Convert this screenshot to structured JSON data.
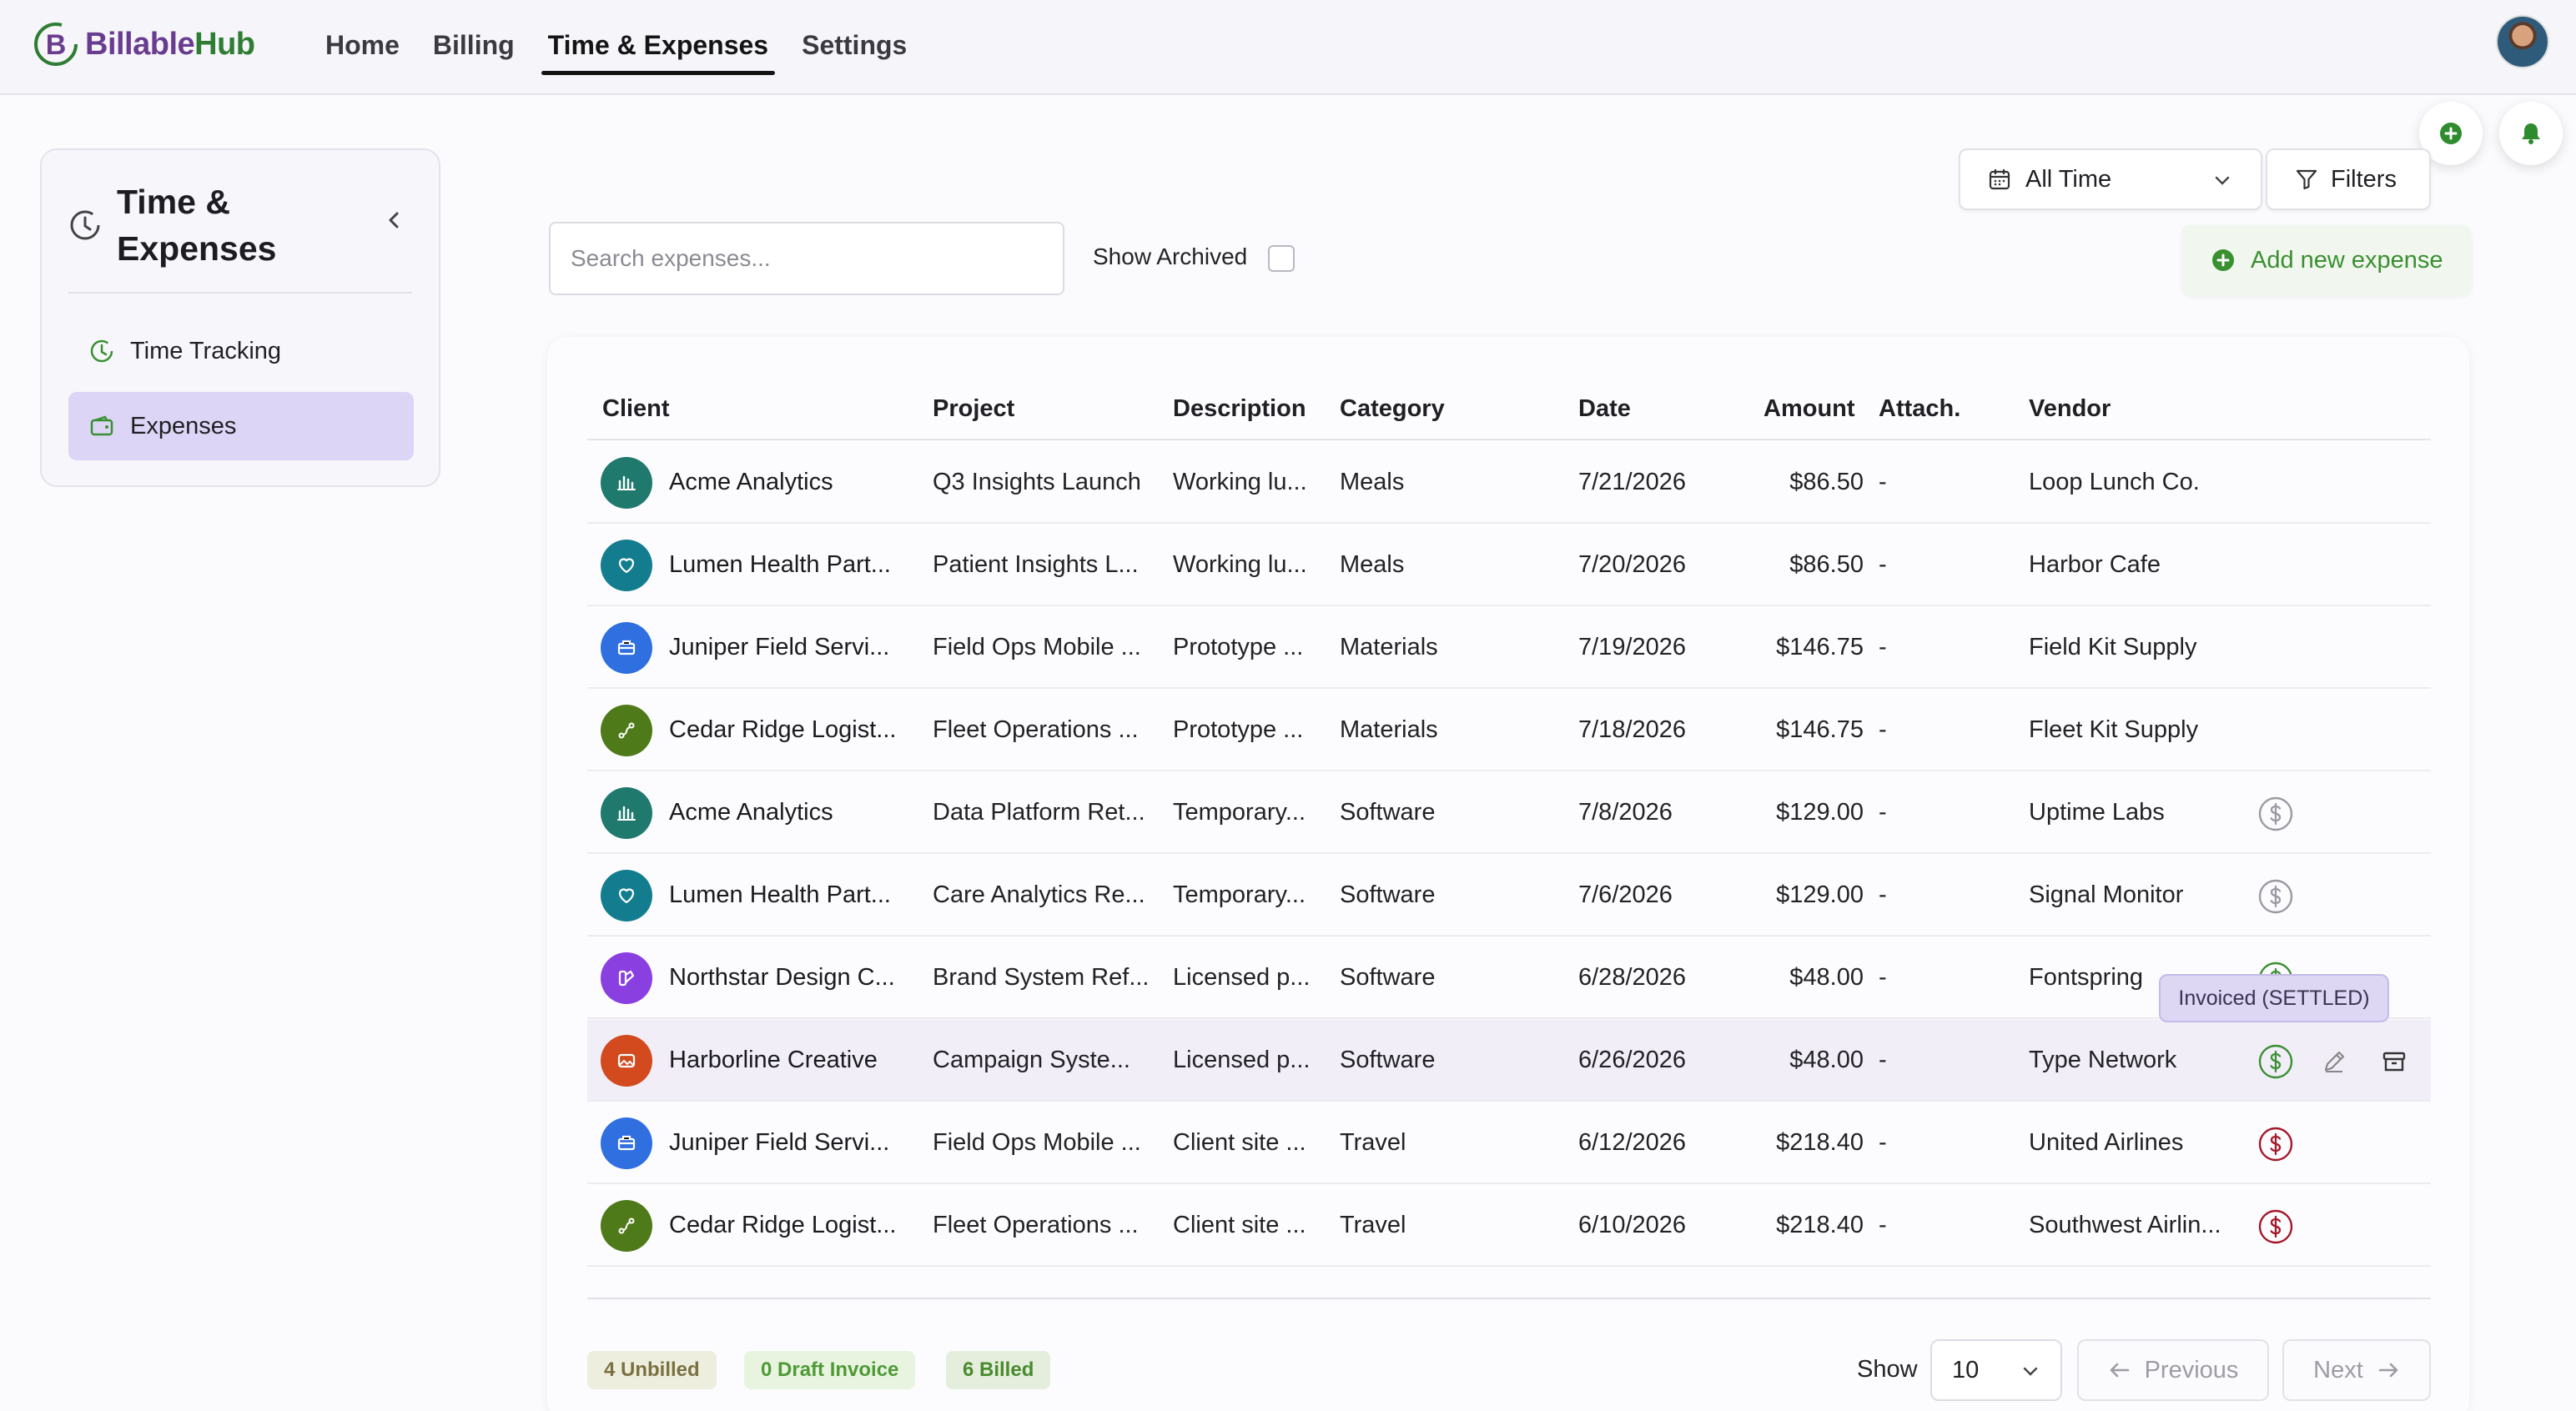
{
  "app": {
    "name_part1": "Billable",
    "name_part2": "Hub"
  },
  "nav": {
    "items": [
      {
        "label": "Home",
        "active": false
      },
      {
        "label": "Billing",
        "active": false
      },
      {
        "label": "Time & Expenses",
        "active": true
      },
      {
        "label": "Settings",
        "active": false
      }
    ]
  },
  "sidebar": {
    "title_line1": "Time &",
    "title_line2": "Expenses",
    "items": [
      {
        "label": "Time Tracking",
        "icon": "clock-icon",
        "active": false
      },
      {
        "label": "Expenses",
        "icon": "wallet-icon",
        "active": true
      }
    ]
  },
  "toolbar": {
    "date_range": "All Time",
    "filters_label": "Filters",
    "search_placeholder": "Search expenses...",
    "search_value": "",
    "show_archived_label": "Show Archived",
    "show_archived_checked": false,
    "add_label": "Add new expense"
  },
  "table": {
    "columns": [
      "Client",
      "Project",
      "Description",
      "Category",
      "Date",
      "Amount",
      "Attach.",
      "Vendor"
    ],
    "rows": [
      {
        "client": "Acme Analytics",
        "project": "Q3 Insights Launch",
        "description": "Working lu...",
        "category": "Meals",
        "date": "7/21/2026",
        "amount": "$86.50",
        "attach": "-",
        "vendor": "Loop Lunch Co.",
        "avatar_color": "#1f7a6d",
        "avatar_icon": "bar-chart-icon",
        "status": "none"
      },
      {
        "client": "Lumen Health Part...",
        "project": "Patient Insights L...",
        "description": "Working lu...",
        "category": "Meals",
        "date": "7/20/2026",
        "amount": "$86.50",
        "attach": "-",
        "vendor": "Harbor Cafe",
        "avatar_color": "#137d8f",
        "avatar_icon": "heart-icon",
        "status": "none"
      },
      {
        "client": "Juniper Field Servi...",
        "project": "Field Ops Mobile ...",
        "description": "Prototype ...",
        "category": "Materials",
        "date": "7/19/2026",
        "amount": "$146.75",
        "attach": "-",
        "vendor": "Field Kit Supply",
        "avatar_color": "#2f6fe0",
        "avatar_icon": "toolbox-icon",
        "status": "none"
      },
      {
        "client": "Cedar Ridge Logist...",
        "project": "Fleet Operations ...",
        "description": "Prototype ...",
        "category": "Materials",
        "date": "7/18/2026",
        "amount": "$146.75",
        "attach": "-",
        "vendor": "Fleet Kit Supply",
        "avatar_color": "#4f7a1a",
        "avatar_icon": "route-icon",
        "status": "none"
      },
      {
        "client": "Acme Analytics",
        "project": "Data Platform Ret...",
        "description": "Temporary...",
        "category": "Software",
        "date": "7/8/2026",
        "amount": "$129.00",
        "attach": "-",
        "vendor": "Uptime Labs",
        "avatar_color": "#1f7a6d",
        "avatar_icon": "bar-chart-icon",
        "status": "unbilled"
      },
      {
        "client": "Lumen Health Part...",
        "project": "Care Analytics Re...",
        "description": "Temporary...",
        "category": "Software",
        "date": "7/6/2026",
        "amount": "$129.00",
        "attach": "-",
        "vendor": "Signal Monitor",
        "avatar_color": "#137d8f",
        "avatar_icon": "heart-icon",
        "status": "unbilled"
      },
      {
        "client": "Northstar Design C...",
        "project": "Brand System Ref...",
        "description": "Licensed p...",
        "category": "Software",
        "date": "6/28/2026",
        "amount": "$48.00",
        "attach": "-",
        "vendor": "Fontspring",
        "avatar_color": "#8a3fe0",
        "avatar_icon": "palette-icon",
        "status": "settled"
      },
      {
        "client": "Harborline Creative",
        "project": "Campaign Syste...",
        "description": "Licensed p...",
        "category": "Software",
        "date": "6/26/2026",
        "amount": "$48.00",
        "attach": "-",
        "vendor": "Type Network",
        "avatar_color": "#d24a1e",
        "avatar_icon": "image-icon",
        "status": "settled"
      },
      {
        "client": "Juniper Field Servi...",
        "project": "Field Ops Mobile ...",
        "description": "Client site ...",
        "category": "Travel",
        "date": "6/12/2026",
        "amount": "$218.40",
        "attach": "-",
        "vendor": "United Airlines",
        "avatar_color": "#2f6fe0",
        "avatar_icon": "toolbox-icon",
        "status": "billed"
      },
      {
        "client": "Cedar Ridge Logist...",
        "project": "Fleet Operations ...",
        "description": "Client site ...",
        "category": "Travel",
        "date": "6/10/2026",
        "amount": "$218.40",
        "attach": "-",
        "vendor": "Southwest Airlin...",
        "avatar_color": "#4f7a1a",
        "avatar_icon": "route-icon",
        "status": "billed"
      }
    ]
  },
  "tooltip": {
    "text": "Invoiced (SETTLED)"
  },
  "footer": {
    "badges": [
      {
        "label": "4 Unbilled"
      },
      {
        "label": "0 Draft Invoice"
      },
      {
        "label": "6 Billed"
      }
    ],
    "show_label": "Show",
    "page_size": "10",
    "previous_label": "Previous",
    "next_label": "Next"
  },
  "colors": {
    "accent_green": "#3a8f31",
    "status_unbilled": "#9a9aa2",
    "status_settled": "#3a8f31",
    "status_billed": "#a3182a",
    "sidebar_active": "#dcd5f5",
    "brand_purple": "#6a3c8f"
  }
}
